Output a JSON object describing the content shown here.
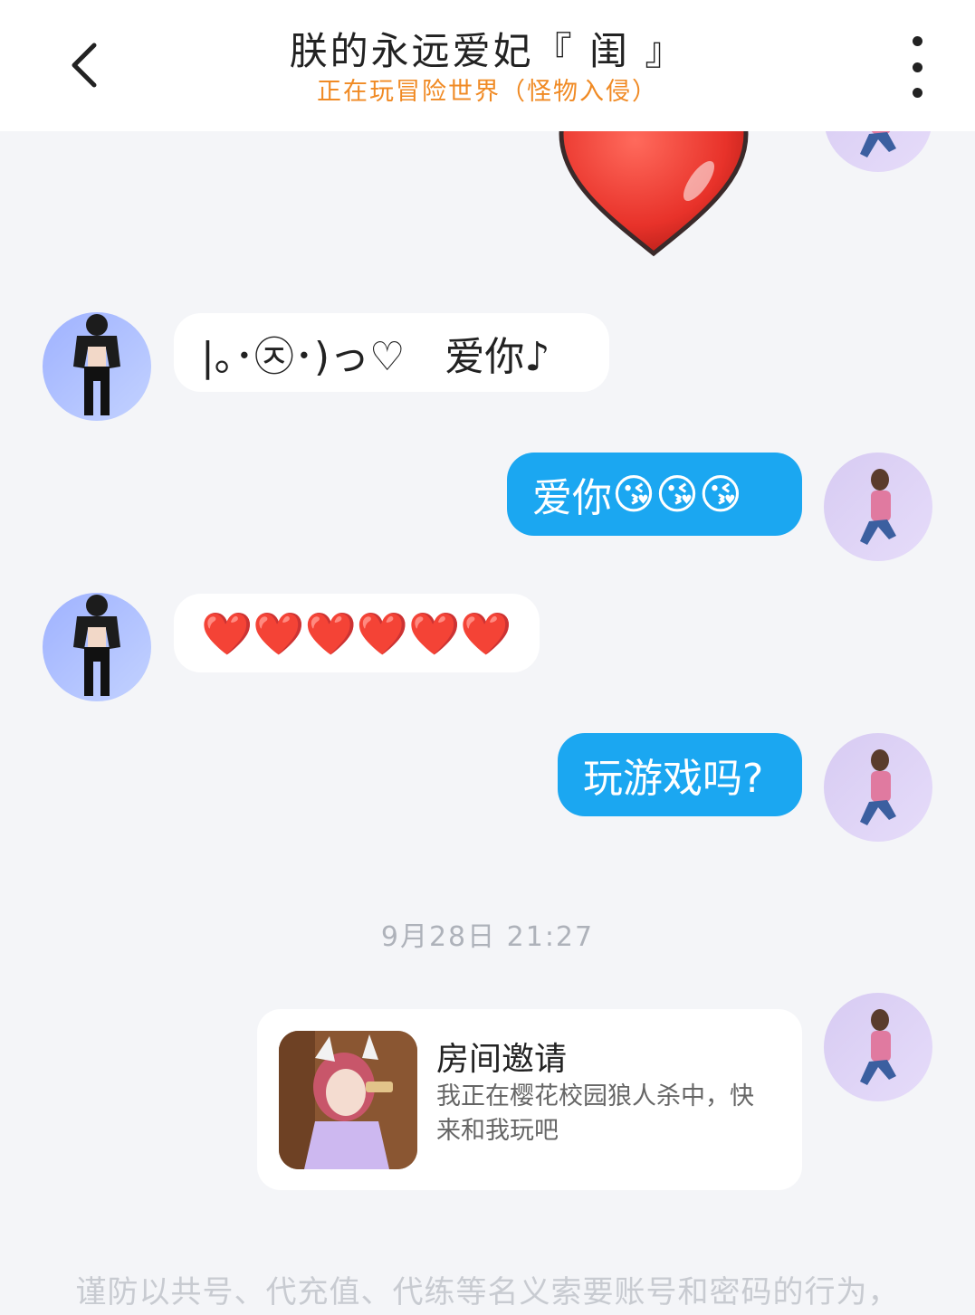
{
  "header": {
    "title": "朕的永远爱妃『 闺 』",
    "subtitle": "正在玩冒险世界（怪物入侵）"
  },
  "messages": [
    {
      "side": "in",
      "text": "|｡･㉨･)っ♡　爱你♪"
    },
    {
      "side": "out",
      "text": "爱你",
      "emojis": "😘😘😘"
    },
    {
      "side": "in",
      "emojis": "❤️❤️❤️❤️❤️❤️"
    },
    {
      "side": "out",
      "text": "玩游戏吗?"
    }
  ],
  "timestamp": "9月28日 21:27",
  "invite": {
    "title": "房间邀请",
    "description": "我正在樱花校园狼人杀中，快来和我玩吧"
  },
  "footer_notice": "谨防以共号、代充值、代练等名义索要账号和密码的行为，",
  "icons": {
    "back": "chevron-left-icon",
    "more": "more-vertical-icon",
    "sticker": "heart-sticker"
  },
  "colors": {
    "outgoing_bubble": "#1ba7f1",
    "incoming_bubble": "#ffffff",
    "subtitle": "#f08a24",
    "background": "#f4f5f8"
  }
}
